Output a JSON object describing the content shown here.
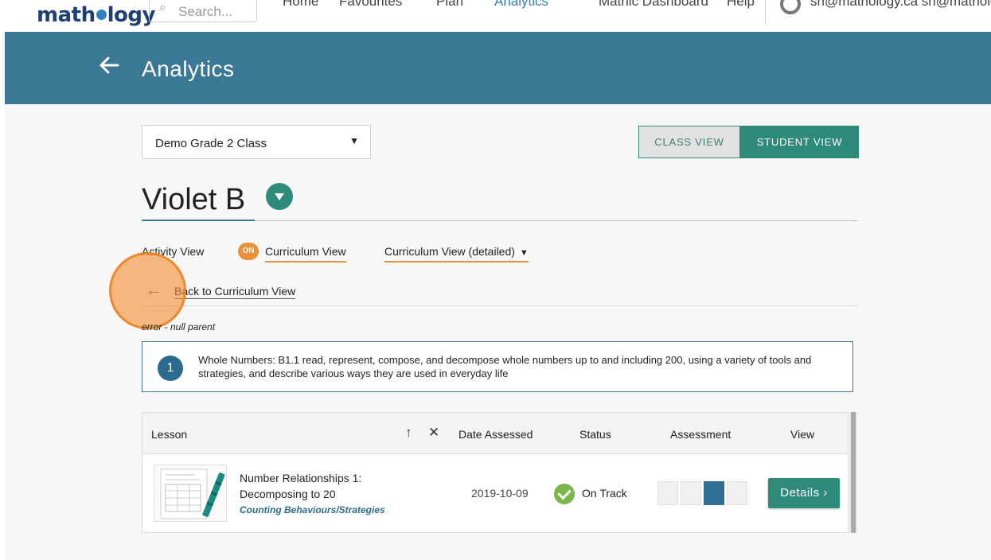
{
  "nav": {
    "logo": "mathology",
    "search_placeholder": "Search...",
    "links": [
      "Home",
      "Favourites",
      "Plan",
      "Analytics",
      "Mathic Dashboard",
      "Help"
    ],
    "user": "sn@mathology.ca sn@mathology.ca"
  },
  "header": {
    "title": "Analytics"
  },
  "class_select": {
    "value": "Demo Grade 2 Class"
  },
  "view_toggle": {
    "class_label": "CLASS VIEW",
    "student_label": "STUDENT VIEW"
  },
  "student": {
    "name": "Violet B"
  },
  "views": {
    "activity": "Activity View",
    "on_badge": "ON",
    "curriculum": "Curriculum View",
    "curriculum_detailed": "Curriculum View (detailed)"
  },
  "back_link": "Back to Curriculum View",
  "error_text": "error - null parent",
  "curriculum": {
    "number": "1",
    "text": "Whole Numbers: B1.1 read, represent, compose, and decompose whole numbers up to and including 200, using a variety of tools and strategies, and describe various ways they are used in everyday life"
  },
  "table": {
    "headers": {
      "lesson": "Lesson",
      "date": "Date Assessed",
      "status": "Status",
      "assessment": "Assessment",
      "view": "View"
    },
    "rows": [
      {
        "title": "Number Relationships 1: Decomposing to 20",
        "subtitle": "Counting Behaviours/Strategies",
        "date": "2019-10-09",
        "status": "On Track",
        "assessment_level": 3,
        "assessment_levels_total": 4,
        "action": "Details ›"
      }
    ]
  },
  "colors": {
    "header_bg": "#3b7896",
    "accent_green": "#2e8b7a",
    "on_badge": "#e99038",
    "assessment_filled": "#2f6f93",
    "status_ok": "#7ab648"
  },
  "icons": [
    "back-arrow-icon",
    "search-icon",
    "dropdown-caret-icon",
    "sort-up-icon",
    "clear-icon",
    "check-circle-icon",
    "chevron-right-icon"
  ]
}
